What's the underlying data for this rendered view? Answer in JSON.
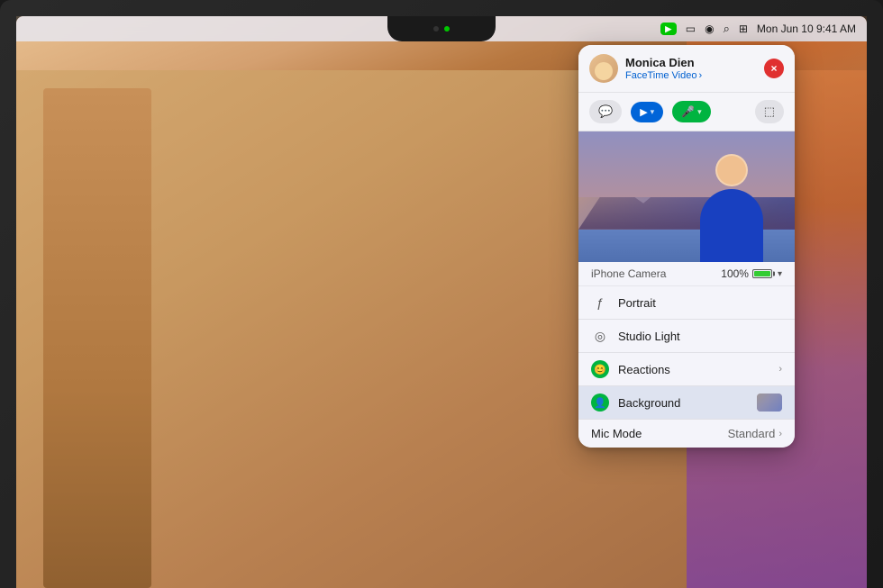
{
  "macbook": {
    "notch": {
      "dot1": "dark",
      "dot2": "green"
    }
  },
  "menubar": {
    "facetime_icon": "▶",
    "battery_icon": "▭",
    "wifi_icon": "◉",
    "search_icon": "⌕",
    "control_icon": "⊞",
    "datetime": "Mon Jun 10  9:41 AM"
  },
  "popup": {
    "contact_name": "Monica Dien",
    "app_label": "FaceTime Video",
    "chevron": "›",
    "close_label": "×",
    "controls": {
      "video_label": "▶",
      "mic_label": "🎤",
      "screen_label": "⬚"
    },
    "video_section": {
      "camera_source": "iPhone Camera",
      "battery_pct": "100%"
    },
    "menu_items": [
      {
        "id": "portrait",
        "icon": "ƒ",
        "icon_type": "text",
        "label": "Portrait",
        "has_chevron": false,
        "selected": false
      },
      {
        "id": "studio-light",
        "icon": "◎",
        "icon_type": "text",
        "label": "Studio Light",
        "has_chevron": false,
        "selected": false
      },
      {
        "id": "reactions",
        "icon": "◉",
        "icon_type": "green",
        "label": "Reactions",
        "has_chevron": true,
        "selected": false
      },
      {
        "id": "background",
        "icon": "👤",
        "icon_type": "green",
        "label": "Background",
        "has_chevron": false,
        "has_thumbnail": true,
        "selected": true
      }
    ],
    "mic_mode": {
      "label": "Mic Mode",
      "value": "Standard",
      "has_chevron": true
    }
  }
}
